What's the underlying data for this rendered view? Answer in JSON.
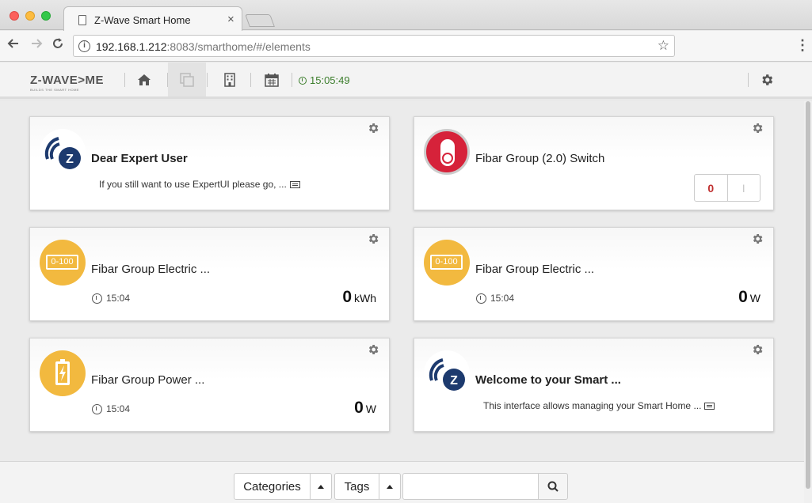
{
  "browser": {
    "tab_title": "Z-Wave Smart Home",
    "tab_close": "×",
    "url_host": "192.168.1.212",
    "url_rest": ":8083/smarthome/#/elements",
    "back_icon": "arrow-left-icon",
    "forward_icon": "arrow-right-icon",
    "reload_icon": "reload-icon",
    "star_icon": "star-icon",
    "menu_icon": "vertical-dots-icon"
  },
  "app_header": {
    "logo_text": "Z-WAVE>ME",
    "logo_subtitle": "BUILDS THE SMART HOME",
    "nav_icons": [
      "home-icon",
      "elements-icon",
      "rooms-icon",
      "calendar-icon"
    ],
    "time": "15:05:49",
    "settings_icon": "gear-icon"
  },
  "cards": [
    {
      "title": "Dear Expert User",
      "description": "If you still want to use ExpertUI please go, ...",
      "icon": "zwave-logo-icon"
    },
    {
      "title": "Fibar Group (2.0) Switch",
      "toggle_off": "0",
      "toggle_on": "I",
      "icon": "switch-icon"
    },
    {
      "title": "Fibar Group Electric ...",
      "time": "15:04",
      "level": "0",
      "unit": "kWh",
      "icon_text": "0-100"
    },
    {
      "title": "Fibar Group Electric ...",
      "time": "15:04",
      "level": "0",
      "unit": "W",
      "icon_text": "0-100"
    },
    {
      "title": "Fibar Group Power ...",
      "time": "15:04",
      "level": "0",
      "unit": "W",
      "icon": "battery-bolt-icon"
    },
    {
      "title": "Welcome to your Smart ...",
      "description": "This interface allows managing your Smart Home ...",
      "icon": "zwave-logo-icon"
    }
  ],
  "footer": {
    "categories_label": "Categories",
    "tags_label": "Tags",
    "search_placeholder": "",
    "search_icon": "search-icon"
  },
  "colors": {
    "accent_green": "#3b7d2b",
    "switch_red": "#d6223a",
    "sensor_yellow": "#f2b93f",
    "zwave_navy": "#1d3a6e"
  }
}
